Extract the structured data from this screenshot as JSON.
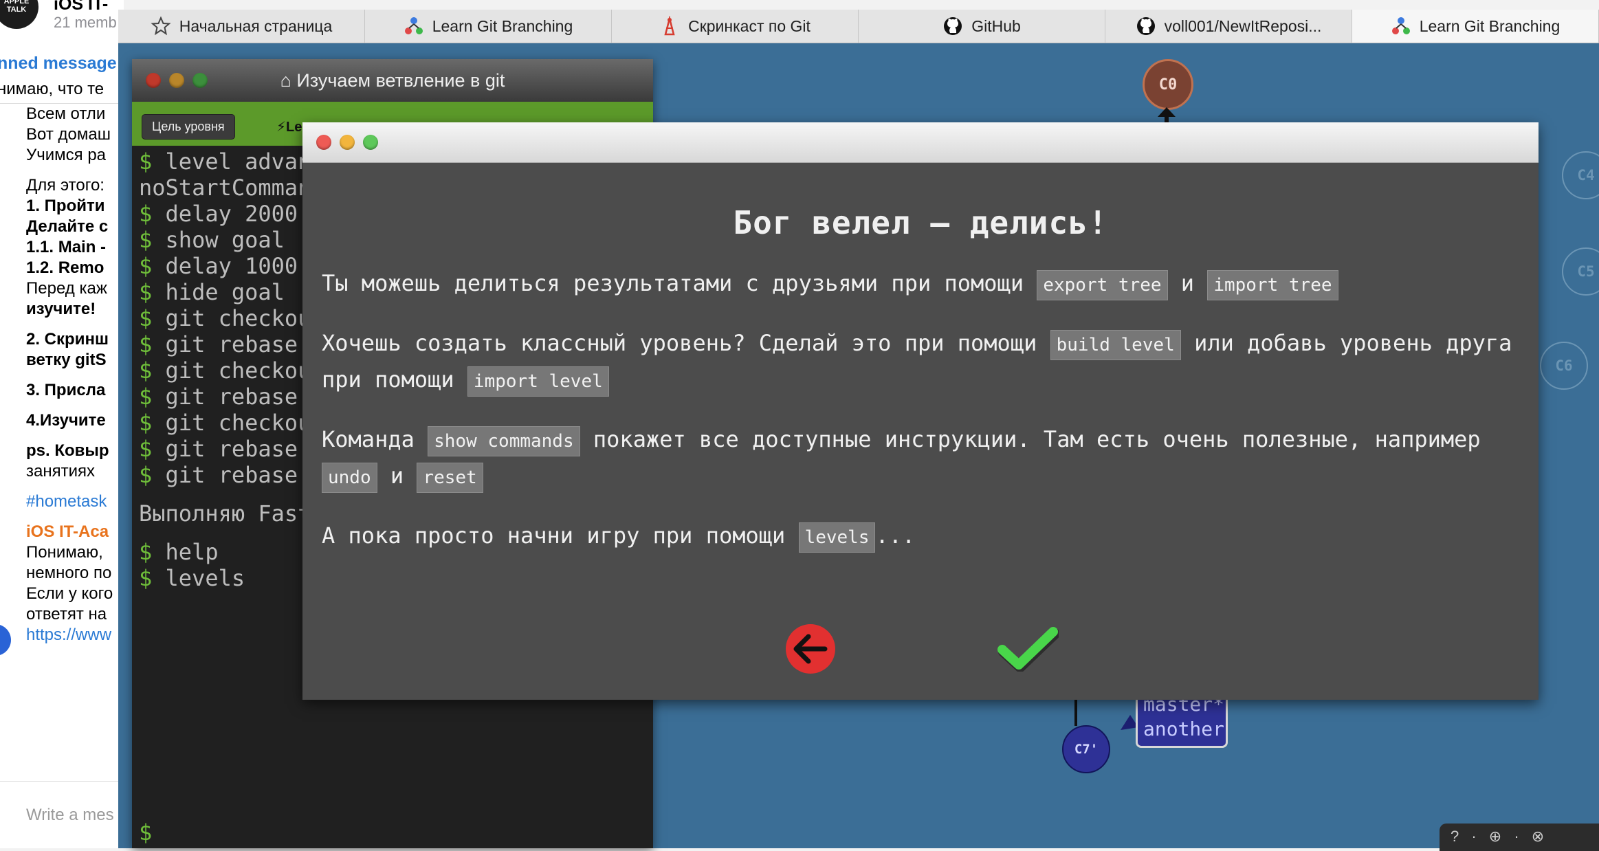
{
  "chat": {
    "avatar_text": "APPLE TALK",
    "title": "iOS IT-",
    "members": "21 memb",
    "pinned_title": "nned message",
    "pinned_text": "нимаю, что те",
    "lines": [
      {
        "text": "Всем отли",
        "style": ""
      },
      {
        "text": "Вот домаш",
        "style": ""
      },
      {
        "text": "Учимся ра",
        "style": ""
      },
      {
        "text": "Для этого:",
        "style": ""
      },
      {
        "text": "1. Пройти",
        "style": "b"
      },
      {
        "text": "Делайте с",
        "style": "b"
      },
      {
        "text": " 1.1. Main -",
        "style": "b"
      },
      {
        "text": " 1.2. Remo",
        "style": "b"
      },
      {
        "text": "Перед каж",
        "style": ""
      },
      {
        "text": "изучите!",
        "style": "b"
      },
      {
        "text": "2. Скринш",
        "style": "b"
      },
      {
        "text": "ветку gitS",
        "style": "b"
      },
      {
        "text": "3. Присла",
        "style": "b"
      },
      {
        "text": "4.Изучите",
        "style": "b"
      },
      {
        "text": "ps. Ковыр",
        "style": "b"
      },
      {
        "text": "занятиях",
        "style": ""
      },
      {
        "text": "#hometask",
        "style": "link"
      },
      {
        "text": "iOS IT-Aca",
        "style": "author"
      },
      {
        "text": "Понимаю,",
        "style": ""
      },
      {
        "text": "немного по",
        "style": ""
      },
      {
        "text": "Если у кого",
        "style": ""
      },
      {
        "text": "ответят на",
        "style": ""
      },
      {
        "text": "https://www",
        "style": "link"
      }
    ],
    "compose_placeholder": "Write a mes"
  },
  "tabs": [
    {
      "label": "Начальная страница",
      "icon": "star-icon",
      "active": false
    },
    {
      "label": "Learn Git Branching",
      "icon": "git-branching-icon",
      "active": false
    },
    {
      "label": "Скринкаст по Git",
      "icon": "screencast-icon",
      "active": false
    },
    {
      "label": "GitHub",
      "icon": "github-icon",
      "active": false
    },
    {
      "label": "voll001/NewItReposi...",
      "icon": "github-icon",
      "active": false
    },
    {
      "label": "Learn Git Branching",
      "icon": "git-branching-icon",
      "active": true
    }
  ],
  "terminal": {
    "title": "Изучаем ветвление в git",
    "goal_button": "Цель уровня",
    "toolbar_label": "Le",
    "lines": [
      {
        "prompt": "$ ",
        "text": "level advan"
      },
      {
        "prompt": "",
        "text": "noStartComman"
      },
      {
        "prompt": "$ ",
        "text": "delay 2000"
      },
      {
        "prompt": "$ ",
        "text": "show goal"
      },
      {
        "prompt": "$ ",
        "text": "delay 1000"
      },
      {
        "prompt": "$ ",
        "text": "hide goal"
      },
      {
        "prompt": "$ ",
        "text": "git checkou"
      },
      {
        "prompt": "$ ",
        "text": "git rebase"
      },
      {
        "prompt": "$ ",
        "text": "git checkou"
      },
      {
        "prompt": "$ ",
        "text": "git rebase"
      },
      {
        "prompt": "$ ",
        "text": "git checkou"
      },
      {
        "prompt": "$ ",
        "text": "git rebase"
      },
      {
        "prompt": "$ ",
        "text": "git rebase"
      }
    ],
    "status_line": "Выполняю Fast",
    "after_lines": [
      {
        "prompt": "$ ",
        "text": "help"
      },
      {
        "prompt": "$ ",
        "text": "levels"
      }
    ],
    "cursor": "$"
  },
  "graph": {
    "c0": "C0",
    "ghosts": [
      "C4",
      "C5",
      "C6"
    ],
    "c7": "C7'",
    "branches": [
      "master*",
      "another"
    ],
    "help_bar": "? · ⊕ · ⊗"
  },
  "modal": {
    "heading": "Бог велел — делись!",
    "p1": {
      "t1": "Ты можешь делиться результатами с друзьями при помощи ",
      "c1": "export tree",
      "t2": " и ",
      "c2": "import tree"
    },
    "p2": {
      "t1": "Хочешь создать классный уровень? Сделай это при помощи ",
      "c1": "build level",
      "t2": " или добавь уровень друга при помощи ",
      "c2": "import level"
    },
    "p3": {
      "t1": "Команда ",
      "c1": "show commands",
      "t2": " покажет все доступные инструкции. Там есть очень полезные, например ",
      "c2": "undo",
      "t3": " и ",
      "c3": "reset"
    },
    "p4": {
      "t1": "А пока просто начни игру при помощи ",
      "c1": "levels",
      "t2": "..."
    }
  }
}
